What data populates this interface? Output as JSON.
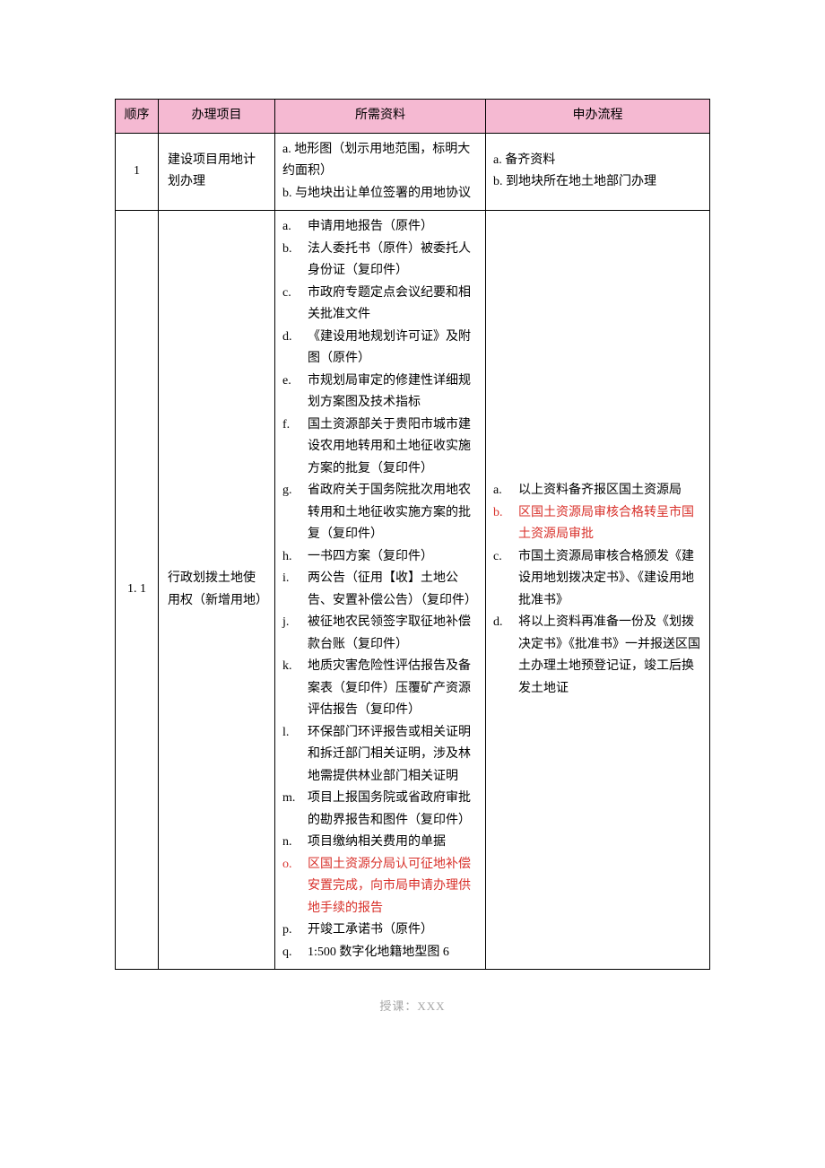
{
  "headers": {
    "seq": "顺序",
    "project": "办理项目",
    "materials": "所需资料",
    "process": "申办流程"
  },
  "rows": [
    {
      "seq": "1",
      "project": "建设项目用地计划办理",
      "materials_plain": [
        "a. 地形图（划示用地范围，标明大约面积）",
        "b. 与地块出让单位签署的用地协议"
      ],
      "process_plain": [
        "a. 备齐资料",
        "b. 到地块所在地土地部门办理"
      ]
    },
    {
      "seq": "1. 1",
      "project": "行政划拨土地使用权（新增用地）",
      "materials_list": [
        {
          "m": "a.",
          "t": "申请用地报告（原件）"
        },
        {
          "m": "b.",
          "t": "法人委托书（原件）被委托人身份证（复印件）"
        },
        {
          "m": "c.",
          "t": "市政府专题定点会议纪要和相关批准文件"
        },
        {
          "m": "d.",
          "t": "《建设用地规划许可证》及附图（原件）"
        },
        {
          "m": "e.",
          "t": "市规划局审定的修建性详细规划方案图及技术指标"
        },
        {
          "m": "f.",
          "t": "国土资源部关于贵阳市城市建设农用地转用和土地征收实施方案的批复（复印件）"
        },
        {
          "m": "g.",
          "t": "省政府关于国务院批次用地农转用和土地征收实施方案的批复（复印件）"
        },
        {
          "m": "h.",
          "t": "一书四方案（复印件）"
        },
        {
          "m": "i.",
          "t": "两公告（征用【收】土地公告、安置补偿公告）（复印件）"
        },
        {
          "m": "j.",
          "t": "被征地农民领签字取征地补偿款台账（复印件）"
        },
        {
          "m": "k.",
          "t": "地质灾害危险性评估报告及备案表（复印件）压覆矿产资源评估报告（复印件）"
        },
        {
          "m": "l.",
          "t": "环保部门环评报告或相关证明和拆迁部门相关证明，涉及林地需提供林业部门相关证明"
        },
        {
          "m": "m.",
          "t": "项目上报国务院或省政府审批的勘界报告和图件（复印件）"
        },
        {
          "m": "n.",
          "t": "项目缴纳相关费用的单据"
        },
        {
          "m": "o.",
          "t": "区国土资源分局认可征地补偿安置完成，向市局申请办理供地手续的报告",
          "red": true
        },
        {
          "m": "p.",
          "t": "开竣工承诺书（原件）"
        },
        {
          "m": "q.",
          "t": "1:500 数字化地籍地型图 6"
        }
      ],
      "process_list": [
        {
          "m": "a.",
          "t": "以上资料备齐报区国土资源局"
        },
        {
          "m": "b.",
          "t": "区国土资源局审核合格转呈市国土资源局审批",
          "red": true
        },
        {
          "m": "c.",
          "t": "市国土资源局审核合格颁发《建设用地划拨决定书》、《建设用地批准书》"
        },
        {
          "m": "d.",
          "t": "将以上资料再准备一份及《划拨决定书》《批准书》一并报送区国土办理土地预登记证，竣工后换发土地证"
        }
      ]
    }
  ],
  "footer": "授课：XXX"
}
